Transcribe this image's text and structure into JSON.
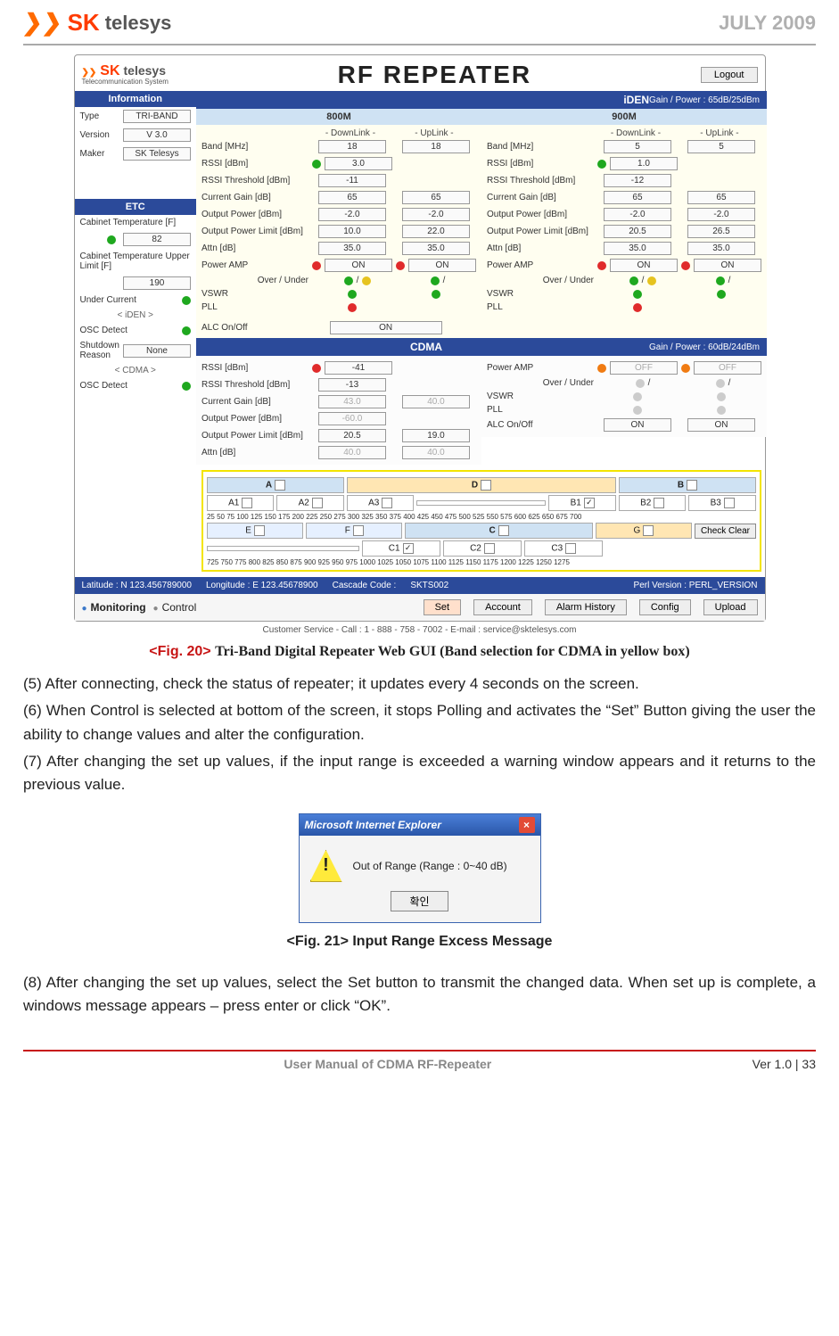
{
  "header": {
    "date": "JULY 2009"
  },
  "logo": {
    "sk": "SK",
    "telesys": "telesys",
    "sub": "Telecommunication System"
  },
  "gui": {
    "title": "RF REPEATER",
    "logout": "Logout",
    "info_header": "Information",
    "info": {
      "type_l": "Type",
      "type_v": "TRI-BAND",
      "ver_l": "Version",
      "ver_v": "V 3.0",
      "maker_l": "Maker",
      "maker_v": "SK Telesys"
    },
    "etc_header": "ETC",
    "etc": {
      "cabtemp_l": "Cabinet Temperature [F]",
      "cabtemp_v": "82",
      "cabtemp_ul_l": "Cabinet Temperature Upper Limit [F]",
      "cabtemp_ul_v": "190",
      "under_l": "Under Current",
      "iden_sep": "< iDEN >",
      "osc1_l": "OSC Detect",
      "shut_l": "Shutdown Reason",
      "shut_v": "None",
      "cdma_sep": "< CDMA >",
      "osc2_l": "OSC Detect"
    },
    "iden_bar": "iDEN",
    "iden_gp": "Gain / Power : 65dB/25dBm",
    "col_800": "800M",
    "col_900": "900M",
    "dl": "- DownLink -",
    "ul": "- UpLink -",
    "rows": {
      "band": "Band [MHz]",
      "rssi": "RSSI [dBm]",
      "rssi_th": "RSSI Threshold [dBm]",
      "cur_gain": "Current Gain [dB]",
      "out_pow": "Output Power [dBm]",
      "out_pow_lim": "Output Power Limit [dBm]",
      "attn": "Attn [dB]",
      "pamp": "Power AMP",
      "ou": "Over / Under",
      "vswr": "VSWR",
      "pll": "PLL",
      "alc": "ALC On/Off"
    },
    "v800": {
      "band_dl": "18",
      "band_ul": "18",
      "rssi_dl": "3.0",
      "rssi_th": "-11",
      "cg_dl": "65",
      "cg_ul": "65",
      "op_dl": "-2.0",
      "op_ul": "-2.0",
      "opl_dl": "10.0",
      "opl_ul": "22.0",
      "at_dl": "35.0",
      "at_ul": "35.0",
      "pamp_dl": "ON",
      "pamp_ul": "ON"
    },
    "v900": {
      "band_dl": "5",
      "band_ul": "5",
      "rssi_dl": "1.0",
      "rssi_th": "-12",
      "cg_dl": "65",
      "cg_ul": "65",
      "op_dl": "-2.0",
      "op_ul": "-2.0",
      "opl_dl": "20.5",
      "opl_ul": "26.5",
      "at_dl": "35.0",
      "at_ul": "35.0",
      "pamp_dl": "ON",
      "pamp_ul": "ON"
    },
    "alc_on": "ON",
    "cdma_bar": "CDMA",
    "cdma_gp": "Gain / Power : 60dB/24dBm",
    "cdma_l": {
      "rssi": "-41",
      "rssi_th": "-13",
      "cg": "43.0",
      "cg_ul": "40.0",
      "op": "-60.0",
      "opl_dl": "20.5",
      "opl_ul": "19.0",
      "at_dl": "40.0",
      "at_ul": "40.0"
    },
    "cdma_r": {
      "pamp_dl": "OFF",
      "pamp_ul": "OFF",
      "alc_dl": "ON",
      "alc_ul": "ON"
    },
    "freq": {
      "A": "A",
      "B": "B",
      "C": "C",
      "D": "D",
      "E": "E",
      "F": "F",
      "G": "G",
      "A1": "A1",
      "A2": "A2",
      "A3": "A3",
      "B1": "B1",
      "B2": "B2",
      "B3": "B3",
      "C1": "C1",
      "C2": "C2",
      "C3": "C3",
      "row1": "25 50 75 100 125 150 175 200 225 250 275 300 325 350 375 400 425 450 475 500 525 550 575 600 625 650 675 700",
      "row2": "725 750 775 800 825 850 875 900 925 950 975 1000 1025 1050 1075 1100 1125 1150 1175 1200 1225 1250 1275",
      "check_clear": "Check Clear"
    },
    "status": {
      "lat": "Latitude : N 123.456789000",
      "lon": "Longitude : E 123.45678900",
      "casc_l": "Cascade Code :",
      "casc_v": "SKTS002",
      "perl": "Perl Version : PERL_VERSION"
    },
    "bottom": {
      "mon": "Monitoring",
      "ctrl": "Control",
      "set": "Set",
      "account": "Account",
      "alarm": "Alarm History",
      "config": "Config",
      "upload": "Upload"
    },
    "customer": "Customer Service  -  Call : 1 - 888 - 758 - 7002  -  E-mail : service@sktelesys.com"
  },
  "caption20": {
    "fig": "<Fig. 20>",
    "desc": " Tri-Band Digital Repeater Web GUI (Band selection for CDMA in yellow box)"
  },
  "para5": "(5) After connecting, check the status of repeater; it updates every 4 seconds on the screen.",
  "para6": "(6) When Control is selected at bottom of the screen, it stops Polling and activates the “Set” Button giving the user the ability to change values and alter the configuration.",
  "para7": "(7) After changing the set up values, if the input range is exceeded a warning window appears and it returns to the previous value.",
  "msgbox": {
    "title": "Microsoft Internet Explorer",
    "msg": "Out of Range (Range : 0~40 dB)",
    "ok": "확인"
  },
  "caption21": "<Fig. 21> Input Range Excess Message",
  "para8": "(8) After changing the set up values, select the Set button to transmit the changed data. When set up is complete, a windows message appears – press enter or click “OK”.",
  "footer": {
    "manual": "User Manual of CDMA RF-Repeater",
    "ver": "Ver 1.0 |    33"
  }
}
